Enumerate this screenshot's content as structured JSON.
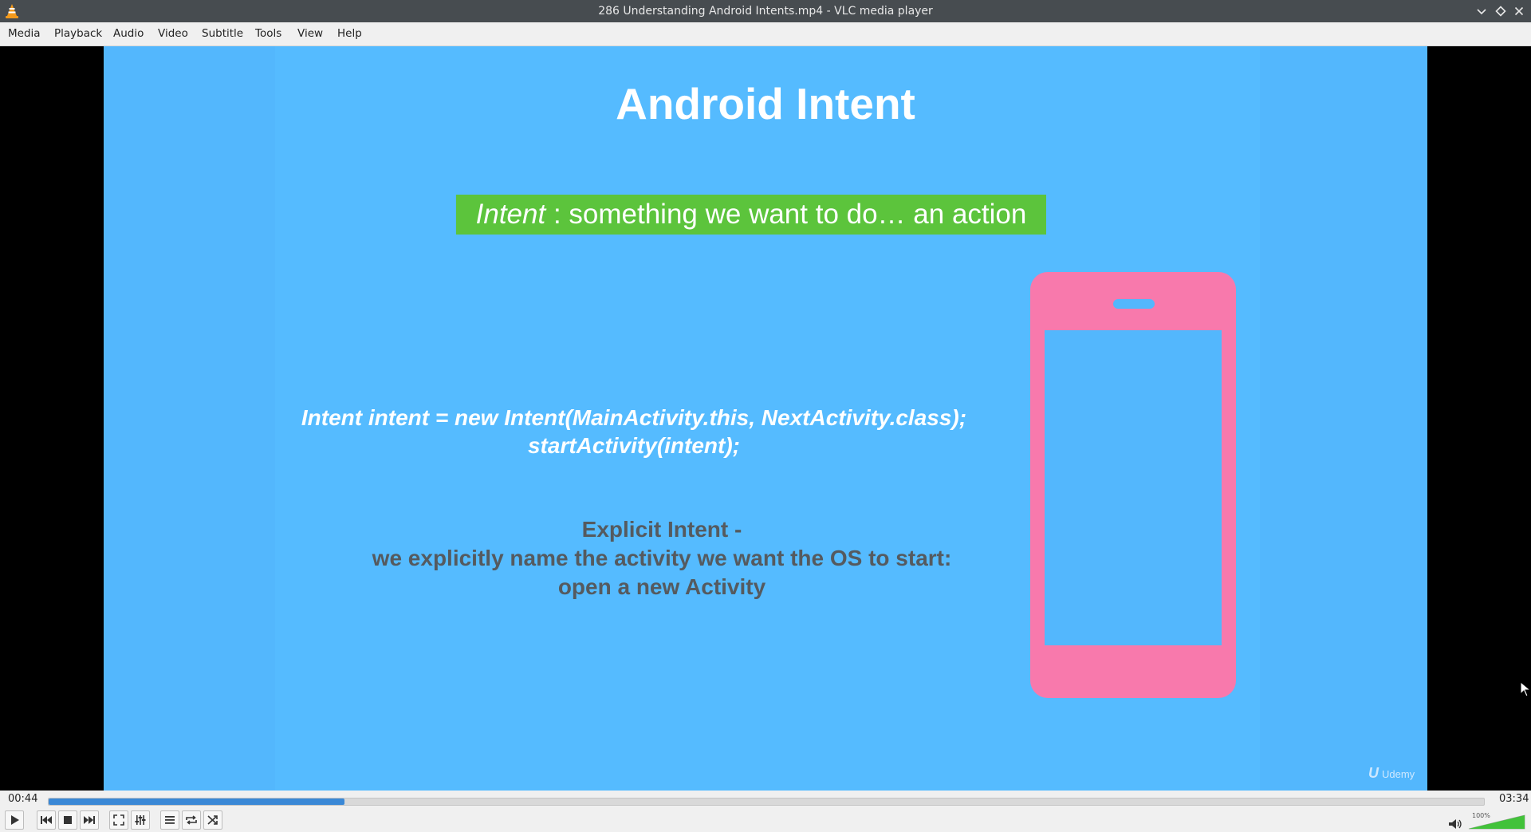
{
  "window": {
    "title": "286 Understanding Android Intents.mp4 - VLC media player"
  },
  "menu": {
    "items": [
      {
        "label": "Media"
      },
      {
        "label": "Playback"
      },
      {
        "label": "Audio"
      },
      {
        "label": "Video"
      },
      {
        "label": "Subtitle"
      },
      {
        "label": "Tools"
      },
      {
        "label": "View"
      },
      {
        "label": "Help"
      }
    ]
  },
  "slide": {
    "title": "Android Intent",
    "banner_em": "Intent",
    "banner_rest": " : something we want to do… an action",
    "code_line1": "Intent intent = new Intent(MainActivity.this, NextActivity.class);",
    "code_line2": "startActivity(intent);",
    "explicit_line1": "Explicit Intent -",
    "explicit_line2": "we explicitly name the activity we want the OS to start:",
    "explicit_line3": "open a new Activity",
    "watermark": "Udemy",
    "colors": {
      "background": "#53b7fd",
      "banner": "#5cc43c",
      "phone": "#f879ac",
      "explicit_text": "#555a5f"
    }
  },
  "player": {
    "elapsed": "00:44",
    "duration": "03:34",
    "progress_fraction": 0.206,
    "volume_label": "100%",
    "volume_fraction": 1.0,
    "accent_color": "#3a88d6"
  }
}
